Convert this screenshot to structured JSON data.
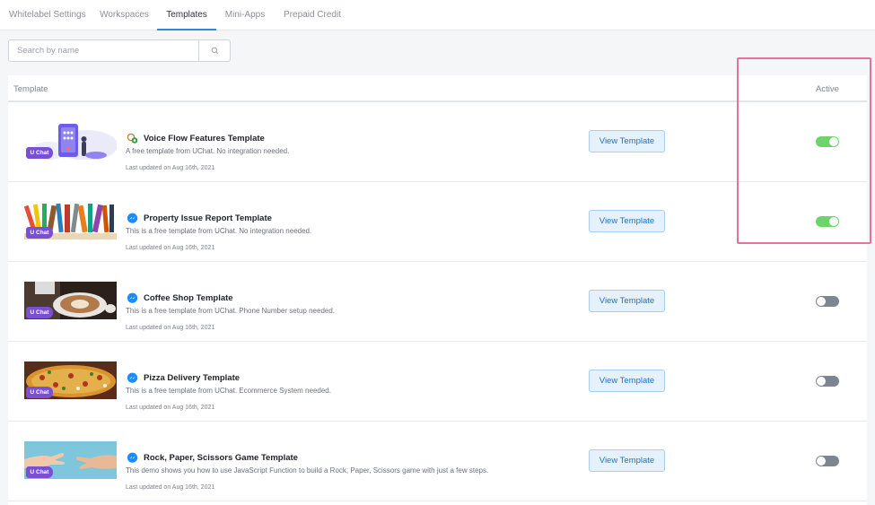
{
  "tabs": [
    {
      "label": "Whitelabel Settings",
      "active": false
    },
    {
      "label": "Workspaces",
      "active": false
    },
    {
      "label": "Templates",
      "active": true
    },
    {
      "label": "Mini-Apps",
      "active": false
    },
    {
      "label": "Prepaid Credit",
      "active": false
    }
  ],
  "search": {
    "placeholder": "Search by name",
    "value": "",
    "icon": "search-icon"
  },
  "table": {
    "headers": {
      "template": "Template",
      "active": "Active"
    },
    "rows": [
      {
        "title": "Voice Flow Features Template",
        "description": "A free template from UChat. No integration needed.",
        "updated": "Last updated on Aug 16th, 2021",
        "button": "View Template",
        "active": true,
        "icon": "voice-flow-icon",
        "badge": "U Chat"
      },
      {
        "title": "Property Issue Report Template",
        "description": "This is a free template from UChat. No integration needed.",
        "updated": "Last updated on Aug 16th, 2021",
        "button": "View Template",
        "active": true,
        "icon": "messenger-icon",
        "badge": "U Chat"
      },
      {
        "title": "Coffee Shop Template",
        "description": "This is a free template from UChat. Phone Number setup needed.",
        "updated": "Last updated on Aug 16th, 2021",
        "button": "View Template",
        "active": false,
        "icon": "messenger-icon",
        "badge": "U Chat"
      },
      {
        "title": "Pizza Delivery Template",
        "description": "This is a free template from UChat. Ecommerce System needed.",
        "updated": "Last updated on Aug 16th, 2021",
        "button": "View Template",
        "active": false,
        "icon": "messenger-icon",
        "badge": "U Chat"
      },
      {
        "title": "Rock, Paper, Scissors Game Template",
        "description": "This demo shows you how to use JavaScript Function to build a Rock, Paper, Scissors game with just a few steps.",
        "updated": "Last updated on Aug 16th, 2021",
        "button": "View Template",
        "active": false,
        "icon": "messenger-icon",
        "badge": "U Chat"
      }
    ]
  },
  "colors": {
    "accent": "#2d8ad8",
    "toggle_on": "#6cd46a",
    "toggle_off": "#7d8591",
    "highlight": "#e8709c",
    "badge": "#7b4fd4"
  }
}
